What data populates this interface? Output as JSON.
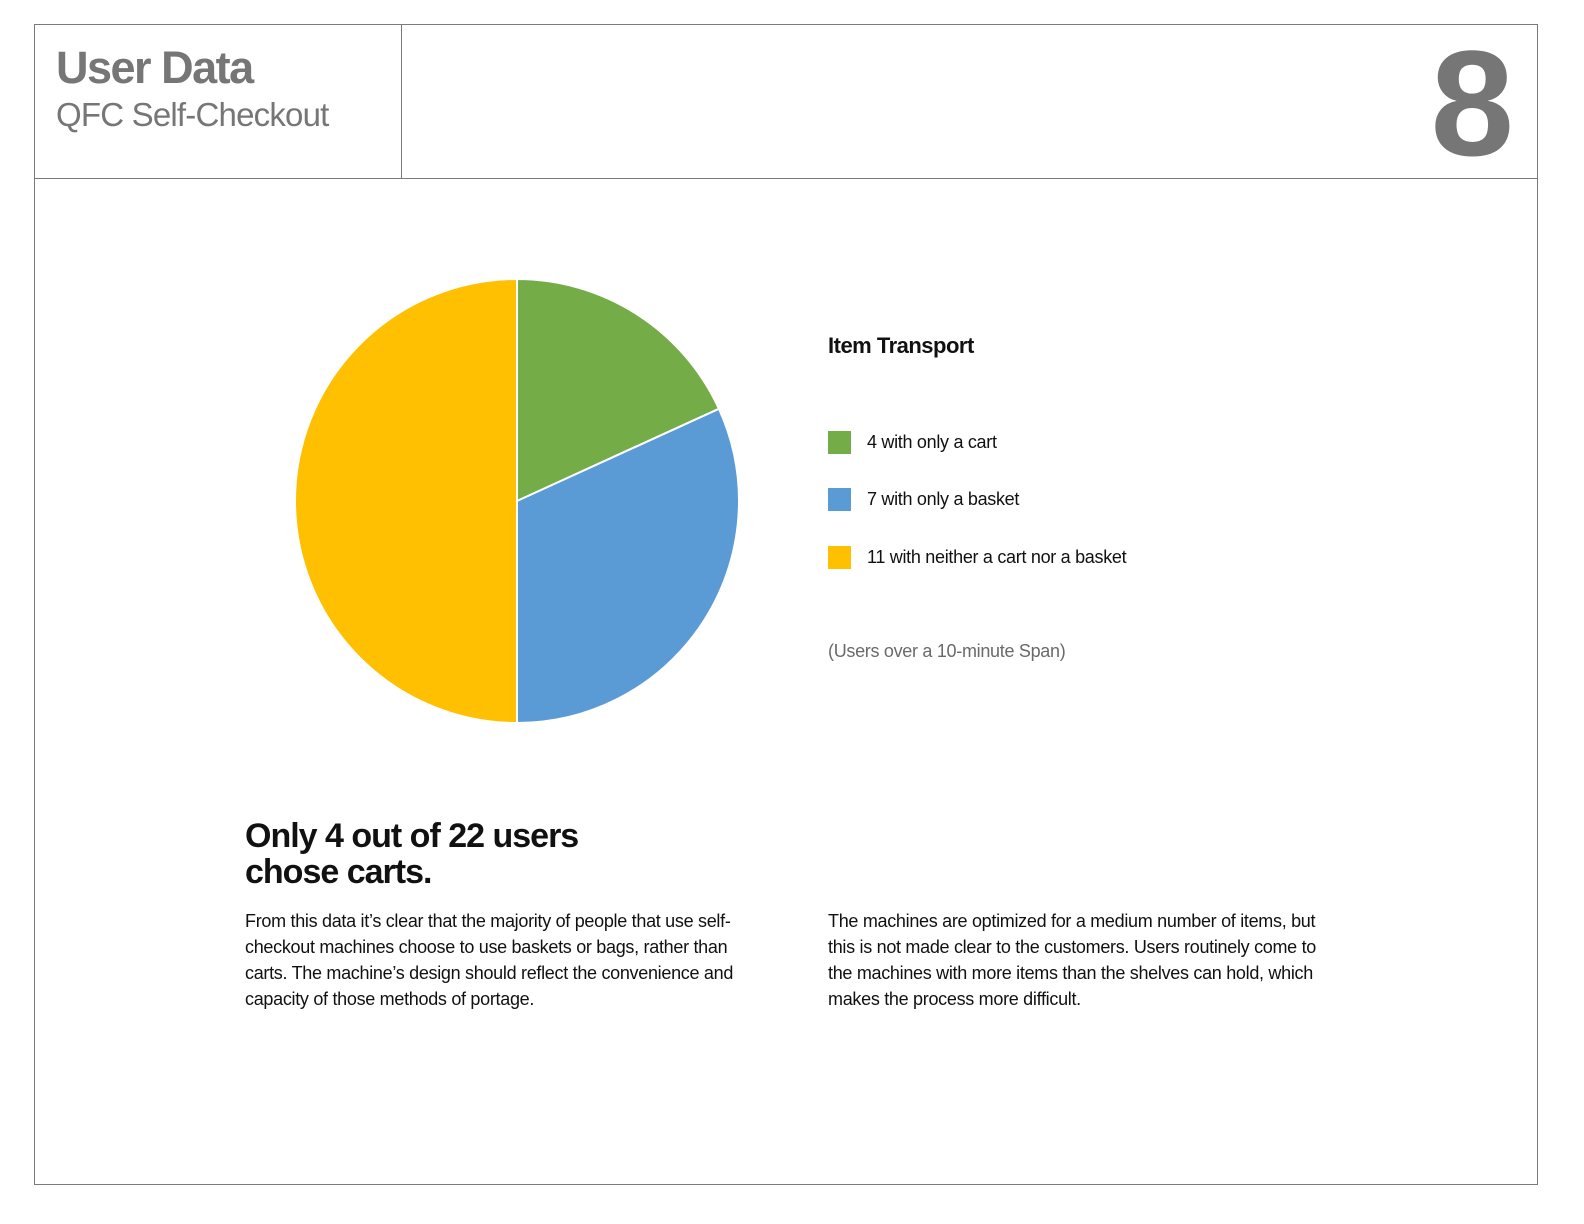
{
  "header": {
    "title": "User Data",
    "subtitle": "QFC Self-Checkout",
    "page_number": "8"
  },
  "chart_data": {
    "type": "pie",
    "title": "Item Transport",
    "note": "(Users over a 10-minute Span)",
    "start_angle_deg": 0,
    "direction": "clockwise",
    "legend_position": "right",
    "slices": [
      {
        "label": "4 with only a cart",
        "value": 4,
        "color": "#74ad47"
      },
      {
        "label": "7 with only a basket",
        "value": 7,
        "color": "#5b9bd5"
      },
      {
        "label": "11 with neither a cart nor a basket",
        "value": 11,
        "color": "#fec000"
      }
    ],
    "total": 22
  },
  "content": {
    "headline": "Only 4 out of 22 users chose carts.",
    "paragraph_left": "From this data it’s clear that the majority of people that use self-checkout machines choose to use baskets or bags, rather than carts. The machine’s design should reflect the convenience and capacity of those methods of portage.",
    "paragraph_right": "The machines are optimized for a medium number of items, but this is not made clear to the customers. Users routinely come to the machines with more items than the shelves can hold, which makes the process more difficult."
  },
  "colors": {
    "frame": "#7a7a7a",
    "header_text": "#767676",
    "slice_border": "#ffffff"
  }
}
